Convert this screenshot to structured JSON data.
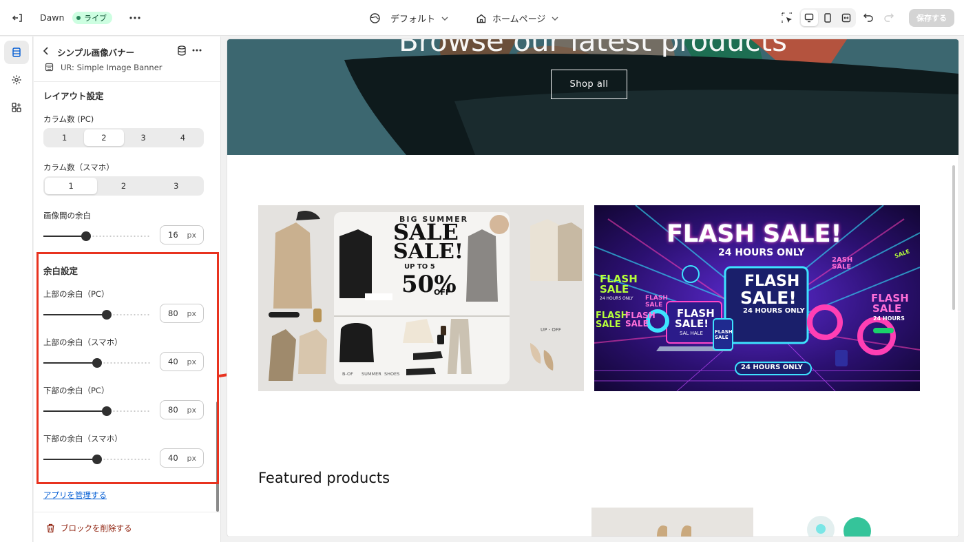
{
  "topbar": {
    "theme_name": "Dawn",
    "live_badge": "ライブ",
    "template_dropdown": "デフォルト",
    "page_dropdown": "ホームページ",
    "save_label": "保存する",
    "icons": [
      "exit-icon",
      "more-icon",
      "globe-icon",
      "chevron-down-icon",
      "home-icon",
      "inspector-icon",
      "desktop-icon",
      "mobile-icon",
      "fullscreen-icon",
      "undo-icon",
      "redo-icon"
    ]
  },
  "sidebar_rail": {
    "items": [
      {
        "name": "sections",
        "icon": "sections-icon",
        "active": true
      },
      {
        "name": "settings",
        "icon": "gear-icon",
        "active": false
      },
      {
        "name": "apps",
        "icon": "apps-icon",
        "active": false
      }
    ]
  },
  "panel": {
    "title": "シンプル画像バナー",
    "subtitle": "UR: Simple Image Banner",
    "layout_section": "レイアウト設定",
    "columns_pc_label": "カラム数 (PC)",
    "columns_pc_options": [
      "1",
      "2",
      "3",
      "4"
    ],
    "columns_pc_selected": 2,
    "columns_sp_label": "カラム数（スマホ）",
    "columns_sp_options": [
      "1",
      "2",
      "3"
    ],
    "columns_sp_selected": 1,
    "gap_label": "画像間の余白",
    "gap_value": "16",
    "gap_fraction": 0.4,
    "padding_section": "余白設定",
    "top_pc_label": "上部の余白（PC）",
    "top_pc_value": "80",
    "top_pc_fraction": 0.59,
    "top_sp_label": "上部の余白（スマホ）",
    "top_sp_value": "40",
    "top_sp_fraction": 0.5,
    "bottom_pc_label": "下部の余白（PC）",
    "bottom_pc_value": "80",
    "bottom_pc_fraction": 0.59,
    "bottom_sp_label": "下部の余白（スマホ）",
    "bottom_sp_value": "40",
    "bottom_sp_fraction": 0.5,
    "unit": "px",
    "manage_apps_link": "アプリを管理する",
    "delete_block": "ブロックを削除する"
  },
  "preview": {
    "hero_title": "Browse our latest products",
    "hero_button": "Shop all",
    "banner_left": {
      "big_summer": "BIG SUMMER",
      "sale1": "SALE",
      "sale2": "SALE!",
      "up_to": "UP TO 5",
      "percent": "50%",
      "off": "OFF",
      "caption": "UP - OFF",
      "shoes": "SHOES",
      "summer": "SUMMER",
      "bttm": "B-OF"
    },
    "banner_right": {
      "headline": "FLASH SALE!",
      "sub": "24 HOURS ONLY",
      "screen1": "FLASH",
      "screen2": "SALE!",
      "screen3": "24 HOURS ONLY",
      "small_flash": "FLASH",
      "small_sale": "SALE",
      "small_24": "24 HOURS ONLY",
      "right_flash": "FLASH",
      "right_sale": "SALE",
      "right_24": "24 HOURS",
      "phone1": "FLASH",
      "phone2": "SALE",
      "laptop1": "FLASH",
      "laptop2": "SALE!",
      "laptop3": "SAL HALE",
      "tag_2ash": "2ASH",
      "tag_sale": "SALE",
      "left_flash2": "FLASH",
      "left_sale2": "SALE",
      "left_flash3": "FLASH",
      "left_sale3": "SALE",
      "badge": "24 HOURS ONLY"
    },
    "featured_title": "Featured products"
  },
  "colors": {
    "accent_highlight": "#e8321f",
    "live_badge_bg": "#cdfee1",
    "link": "#005bd3",
    "danger": "#8e1f0b",
    "hero_bg": "#3c6770"
  }
}
